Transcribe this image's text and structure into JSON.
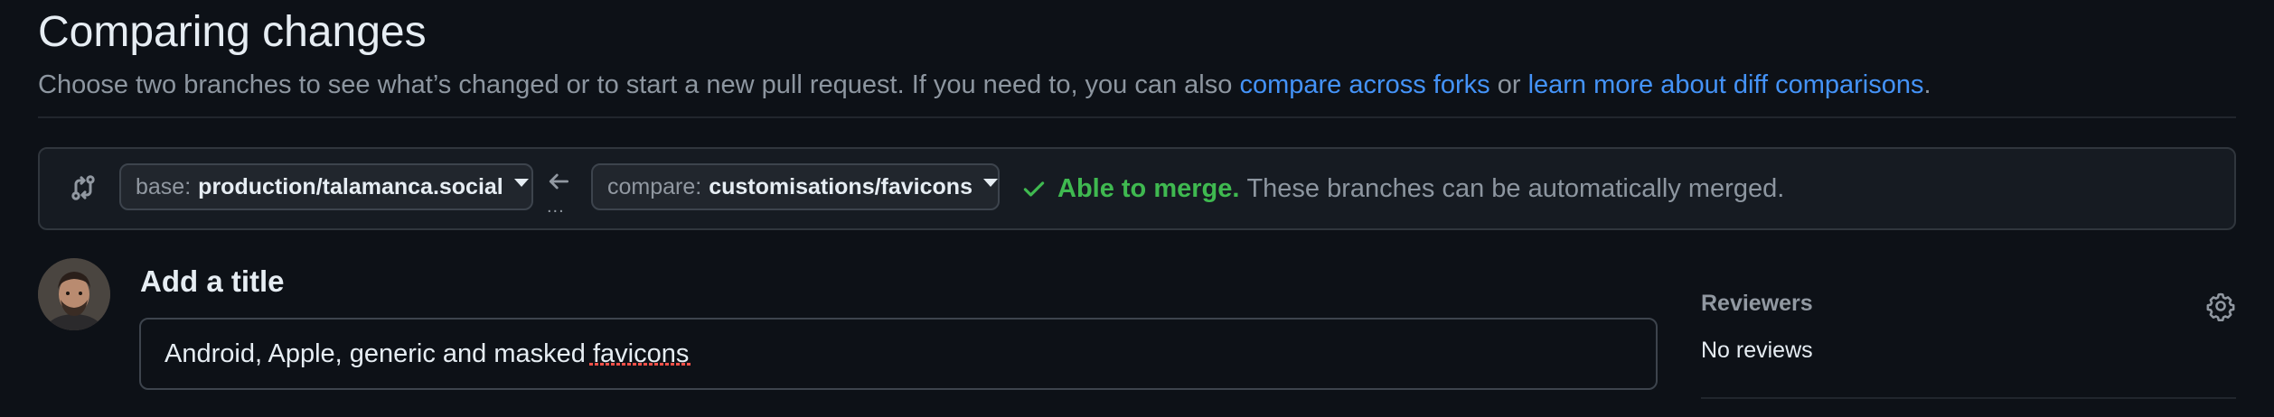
{
  "header": {
    "title": "Comparing changes",
    "description_prefix": "Choose two branches to see what’s changed or to start a new pull request. If you need to, you can also ",
    "link_compare_forks": "compare across forks",
    "description_or": " or ",
    "link_learn_more": "learn more about diff comparisons",
    "description_suffix": "."
  },
  "compare_bar": {
    "compare_icon": "git-compare-icon",
    "base": {
      "label": "base:",
      "value": "production/talamanca.social"
    },
    "arrow_icon": "arrow-left-icon",
    "dots": "...",
    "compare": {
      "label": "compare:",
      "value": "customisations/favicons"
    },
    "merge": {
      "icon": "check-icon",
      "status": "Able to merge.",
      "message": "These branches can be automatically merged."
    }
  },
  "pr_form": {
    "avatar": "user-avatar",
    "heading": "Add a title",
    "title_value": "Android, Apple, generic and masked favicons"
  },
  "sidebar": {
    "reviewers_label": "Reviewers",
    "reviewers_value": "No reviews",
    "settings_icon": "gear-icon"
  },
  "colors": {
    "background": "#0d1117",
    "accent_link": "#4493f8",
    "success": "#3fb950",
    "muted": "#8d96a0"
  }
}
